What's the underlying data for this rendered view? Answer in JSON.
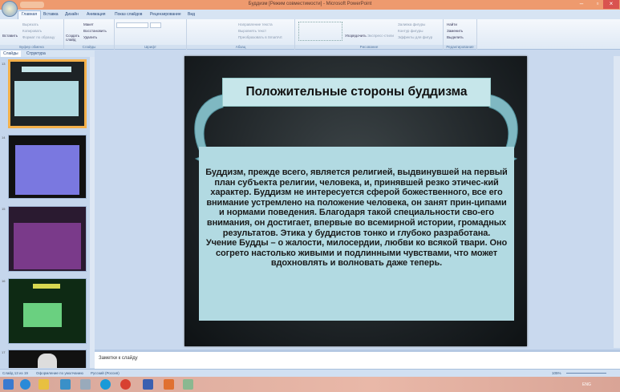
{
  "window": {
    "title": "Буддизм [Режим совместимости] - Microsoft PowerPoint"
  },
  "ribbon": {
    "tabs": [
      "Главная",
      "Вставка",
      "Дизайн",
      "Анимация",
      "Показ слайдов",
      "Рецензирование",
      "Вид"
    ],
    "groups": [
      "Буфер обмена",
      "Слайды",
      "Шрифт",
      "Абзац",
      "Рисование",
      "Редактирование"
    ],
    "clipboard": {
      "paste": "Вставить",
      "cut": "Вырезать",
      "copy": "Копировать",
      "format": "Формат по образцу"
    },
    "slides": {
      "create": "Создать слайд",
      "layout": "Макет",
      "reset": "Восстановить",
      "delete": "Удалить"
    },
    "paragraph": {
      "direction": "Направление текста",
      "align": "Выровнять текст",
      "smartart": "Преобразовать в SmartArt"
    },
    "drawing": {
      "arrange": "Упорядочить",
      "styles": "Экспресс-стили",
      "fill": "Заливка фигуры",
      "outline": "Контур фигуры",
      "effects": "Эффекты для фигур"
    },
    "editing": {
      "find": "Найти",
      "replace": "Заменить",
      "select": "Выделить"
    }
  },
  "panel": {
    "tabs": [
      "Слайды",
      "Структура"
    ],
    "slide_numbers": [
      "13",
      "14",
      "15",
      "16",
      "17"
    ]
  },
  "slide": {
    "title": "Положительные стороны буддизма",
    "paragraphs": [
      "Буддизм, прежде всего, является религией, выдвинувшей на первый план субъекта религии, человека, и, принявшей резко этичес-кий характер. Буддизм не интересуется сферой божественного, все его внимание устремлено на положение человека, он занят прин-ципами и нормами поведения. Благодаря такой специальности сво-его внимания, он достигает, впервые во всемирной истории, громадных результатов. Этика у буддистов тонко и глубоко разработана.",
      "Учение Будды – о жалости, милосердии, любви ко всякой твари. Оно согрето настолько живыми и подлинными чувствами, что может вдохновлять и волновать даже теперь."
    ]
  },
  "notes": {
    "placeholder": "Заметки к слайду"
  },
  "status": {
    "slide": "Слайд 13 из 19",
    "theme": "Оформление по умолчанию",
    "language": "Русский (Россия)",
    "zoom": "105%"
  },
  "taskbar": {
    "lang": "ENG"
  },
  "colors": {
    "titlebar": "#ee9a6e",
    "title_box": "#c6e6ea",
    "content_box": "#b2dae2",
    "arrow": "#7fb8c2"
  }
}
